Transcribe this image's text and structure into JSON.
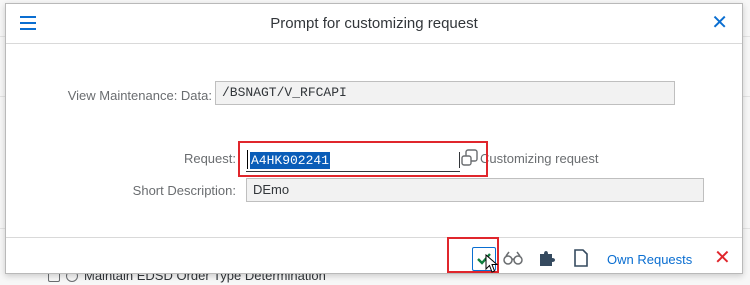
{
  "background": {
    "row_text": "Maintain EDSD Order Type Determination"
  },
  "dialog": {
    "title": "Prompt for customizing request",
    "menu_icon": "hamburger-icon",
    "close_icon": "close-icon"
  },
  "form": {
    "view_label": "View Maintenance: Data:",
    "view_value": "/BSNAGT/V_RFCAPI",
    "request_label": "Request:",
    "request_value": "A4HK902241",
    "request_type": "Customizing request",
    "short_desc_label": "Short Description:",
    "short_desc_value": "DEmo"
  },
  "footer": {
    "own_requests_label": "Own Requests",
    "icons": [
      "checkmark-icon",
      "glasses-icon",
      "puzzle-icon",
      "document-icon",
      "cancel-icon"
    ]
  },
  "colors": {
    "accent": "#0a6ed1",
    "highlight_border": "#e0262c",
    "confirm": "#107e3e",
    "cancel": "#e0262c"
  }
}
